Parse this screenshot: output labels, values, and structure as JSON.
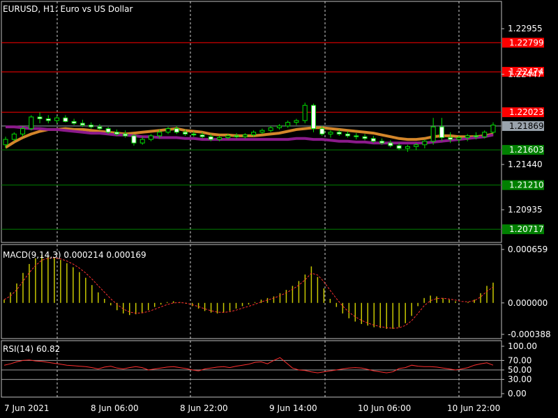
{
  "chart_data": [
    {
      "type": "candlestick",
      "title": "EURUSD, H1:  Euro vs US Dollar",
      "x_labels": [
        "7 Jun 2021",
        "8 Jun 06:00",
        "8 Jun 22:00",
        "9 Jun 14:00",
        "10 Jun 06:00",
        "10 Jun 22:00"
      ],
      "y_ticks": [
        "1.22955",
        "1.22447",
        "1.21440",
        "1.20935"
      ],
      "ylim": [
        1.2057,
        1.2326
      ],
      "levels": [
        {
          "value": 1.22799,
          "label": "1.22799",
          "color": "#ff0000"
        },
        {
          "value": 1.22474,
          "label": "1.22474",
          "color": "#ff0000"
        },
        {
          "value": 1.22023,
          "label": "1.22023",
          "color": "#ff0000"
        },
        {
          "value": 1.21603,
          "label": "1.21603",
          "color": "#008000"
        },
        {
          "value": 1.2121,
          "label": "1.21210",
          "color": "#008000"
        },
        {
          "value": 1.20717,
          "label": "1.20717",
          "color": "#008000"
        }
      ],
      "current_price": {
        "value": 1.21869,
        "label": "1.21869",
        "color": "#9aa3ad"
      },
      "candles": [
        [
          1.2166,
          1.2175,
          1.2162,
          1.2172
        ],
        [
          1.2172,
          1.218,
          1.217,
          1.2178
        ],
        [
          1.2178,
          1.2186,
          1.2175,
          1.2184
        ],
        [
          1.2184,
          1.2199,
          1.2182,
          1.2197
        ],
        [
          1.2197,
          1.2202,
          1.219,
          1.2195
        ],
        [
          1.2195,
          1.2199,
          1.219,
          1.2193
        ],
        [
          1.2193,
          1.2198,
          1.219,
          1.2196
        ],
        [
          1.2196,
          1.2199,
          1.2191,
          1.2192
        ],
        [
          1.2192,
          1.2195,
          1.2188,
          1.219
        ],
        [
          1.219,
          1.2194,
          1.2186,
          1.2188
        ],
        [
          1.2188,
          1.2191,
          1.2184,
          1.2186
        ],
        [
          1.2186,
          1.2189,
          1.2182,
          1.2184
        ],
        [
          1.2184,
          1.2186,
          1.2178,
          1.218
        ],
        [
          1.218,
          1.2183,
          1.2176,
          1.2178
        ],
        [
          1.2178,
          1.2182,
          1.2174,
          1.2176
        ],
        [
          1.2176,
          1.2178,
          1.2165,
          1.2168
        ],
        [
          1.2168,
          1.2175,
          1.2166,
          1.2172
        ],
        [
          1.2172,
          1.2178,
          1.217,
          1.2176
        ],
        [
          1.2176,
          1.2183,
          1.2173,
          1.218
        ],
        [
          1.218,
          1.2186,
          1.2178,
          1.2184
        ],
        [
          1.2184,
          1.2187,
          1.2178,
          1.218
        ],
        [
          1.218,
          1.2183,
          1.2176,
          1.2178
        ],
        [
          1.2178,
          1.2181,
          1.2175,
          1.2177
        ],
        [
          1.2177,
          1.218,
          1.2173,
          1.2175
        ],
        [
          1.2175,
          1.2178,
          1.217,
          1.2172
        ],
        [
          1.2172,
          1.2176,
          1.217,
          1.2174
        ],
        [
          1.2174,
          1.2178,
          1.2172,
          1.2176
        ],
        [
          1.2176,
          1.2179,
          1.2173,
          1.2175
        ],
        [
          1.2175,
          1.2179,
          1.2173,
          1.2177
        ],
        [
          1.2177,
          1.2182,
          1.2175,
          1.218
        ],
        [
          1.218,
          1.2184,
          1.2178,
          1.2182
        ],
        [
          1.2182,
          1.2187,
          1.218,
          1.2185
        ],
        [
          1.2185,
          1.2189,
          1.2183,
          1.2187
        ],
        [
          1.2187,
          1.2193,
          1.2185,
          1.2191
        ],
        [
          1.2191,
          1.2195,
          1.2188,
          1.2193
        ],
        [
          1.2193,
          1.2213,
          1.219,
          1.221
        ],
        [
          1.221,
          1.2212,
          1.218,
          1.2184
        ],
        [
          1.2184,
          1.2187,
          1.2176,
          1.2178
        ],
        [
          1.2178,
          1.2182,
          1.2174,
          1.218
        ],
        [
          1.218,
          1.2183,
          1.2176,
          1.2178
        ],
        [
          1.2178,
          1.2181,
          1.2174,
          1.2176
        ],
        [
          1.2176,
          1.2179,
          1.2172,
          1.2175
        ],
        [
          1.2175,
          1.2178,
          1.2171,
          1.2173
        ],
        [
          1.2173,
          1.2176,
          1.2168,
          1.217
        ],
        [
          1.217,
          1.2173,
          1.2166,
          1.2168
        ],
        [
          1.2168,
          1.2171,
          1.2163,
          1.2165
        ],
        [
          1.2165,
          1.2168,
          1.216,
          1.2162
        ],
        [
          1.2162,
          1.2166,
          1.2158,
          1.2164
        ],
        [
          1.2164,
          1.2168,
          1.216,
          1.2166
        ],
        [
          1.2166,
          1.2172,
          1.2162,
          1.217
        ],
        [
          1.217,
          1.2196,
          1.2166,
          1.2186
        ],
        [
          1.2186,
          1.2196,
          1.217,
          1.2174
        ],
        [
          1.2174,
          1.218,
          1.2168,
          1.2172
        ],
        [
          1.2172,
          1.2176,
          1.2168,
          1.2174
        ],
        [
          1.2174,
          1.2178,
          1.217,
          1.2176
        ],
        [
          1.2176,
          1.218,
          1.2172,
          1.2175
        ],
        [
          1.2175,
          1.2182,
          1.2173,
          1.218
        ],
        [
          1.218,
          1.2191,
          1.2178,
          1.2188
        ]
      ],
      "moving_averages": [
        {
          "color": "#d4862a",
          "values": [
            1.2163,
            1.2169,
            1.2174,
            1.2178,
            1.2181,
            1.2183,
            1.2183,
            1.2184,
            1.2183,
            1.2183,
            1.2182,
            1.2181,
            1.218,
            1.2179,
            1.2178,
            1.2179,
            1.218,
            1.2181,
            1.2182,
            1.2183,
            1.2184,
            1.2182,
            1.2181,
            1.218,
            1.2178,
            1.2177,
            1.2177,
            1.2176,
            1.2176,
            1.2176,
            1.2177,
            1.2178,
            1.2179,
            1.2181,
            1.2183,
            1.2184,
            1.2185,
            1.2185,
            1.2184,
            1.2183,
            1.2182,
            1.2181,
            1.218,
            1.2179,
            1.2177,
            1.2175,
            1.2173,
            1.2172,
            1.2172,
            1.2173,
            1.2175,
            1.2176,
            1.2176,
            1.2175,
            1.2175,
            1.2175,
            1.2176,
            1.2178
          ]
        },
        {
          "color": "#8b1a8b",
          "values": [
            1.2186,
            1.2186,
            1.2185,
            1.2184,
            1.2184,
            1.2183,
            1.2183,
            1.2182,
            1.2181,
            1.218,
            1.2179,
            1.2179,
            1.2178,
            1.2177,
            1.2177,
            1.2176,
            1.2175,
            1.2175,
            1.2174,
            1.2174,
            1.2174,
            1.2173,
            1.2173,
            1.2172,
            1.2172,
            1.2172,
            1.2172,
            1.2172,
            1.2172,
            1.2172,
            1.2172,
            1.2172,
            1.2172,
            1.2172,
            1.2173,
            1.2173,
            1.2172,
            1.2172,
            1.2171,
            1.217,
            1.217,
            1.2169,
            1.2169,
            1.2168,
            1.2168,
            1.2168,
            1.2168,
            1.2168,
            1.2168,
            1.2168,
            1.2169,
            1.217,
            1.2171,
            1.2172,
            1.2173,
            1.2174,
            1.2175,
            1.2177
          ]
        }
      ]
    },
    {
      "type": "histogram",
      "title": "MACD(9,14,3) 0.000214 0.000169",
      "y_ticks": [
        "0.000659",
        "0.000000",
        "-0.000388"
      ],
      "ylim": [
        -0.00044,
        0.00072
      ],
      "bar_color": "#c8c800",
      "signal_color": "#ff3030",
      "values": [
        4e-05,
        0.00013,
        0.00024,
        0.00037,
        0.00048,
        0.00055,
        0.00059,
        0.00058,
        0.00056,
        0.00053,
        0.00049,
        0.00044,
        0.00038,
        0.00031,
        0.00022,
        0.00013,
        5e-05,
        -3e-05,
        -9e-05,
        -0.00013,
        -0.00015,
        -0.00014,
        -0.00012,
        -9e-05,
        -5e-05,
        -2e-05,
        1e-05,
        2e-05,
        1e-05,
        -1e-05,
        -4e-05,
        -7e-05,
        -0.0001,
        -0.00012,
        -0.00013,
        -0.00012,
        -0.0001,
        -7e-05,
        -4e-05,
        -2e-05,
        1e-05,
        4e-05,
        6e-05,
        8e-05,
        0.00012,
        0.00016,
        0.00021,
        0.00027,
        0.00035,
        0.00045,
        0.00032,
        0.00018,
        5e-05,
        -5e-05,
        -0.00013,
        -0.00019,
        -0.00023,
        -0.00026,
        -0.00028,
        -0.0003,
        -0.00031,
        -0.00032,
        -0.00032,
        -0.0003,
        -0.00025,
        -0.00016,
        -4e-05,
        6e-05,
        9e-05,
        8e-05,
        6e-05,
        4e-05,
        2e-05,
        0.0,
        1e-05,
        4e-05,
        0.00012,
        0.00021,
        0.00025
      ]
    },
    {
      "type": "line",
      "title": "RSI(14) 60.82",
      "y_ticks": [
        "100.00",
        "70.00",
        "50.00",
        "30.00",
        "0.00"
      ],
      "ylim": [
        0,
        100
      ],
      "levels": [
        70,
        50,
        30
      ],
      "line_color": "#ff3030",
      "values": [
        60,
        63,
        67,
        70,
        71,
        69,
        68,
        66,
        64,
        62,
        60,
        59,
        58,
        57,
        55,
        52,
        56,
        58,
        54,
        52,
        55,
        57,
        55,
        50,
        52,
        54,
        56,
        57,
        55,
        53,
        50,
        48,
        52,
        54,
        56,
        57,
        55,
        58,
        60,
        62,
        66,
        67,
        63,
        70,
        76,
        65,
        54,
        50,
        49,
        46,
        44,
        46,
        48,
        50,
        52,
        54,
        55,
        54,
        51,
        48,
        46,
        44,
        46,
        53,
        55,
        60,
        58,
        57,
        57,
        56,
        54,
        52,
        50,
        52,
        55,
        60,
        63,
        65,
        60
      ]
    }
  ]
}
